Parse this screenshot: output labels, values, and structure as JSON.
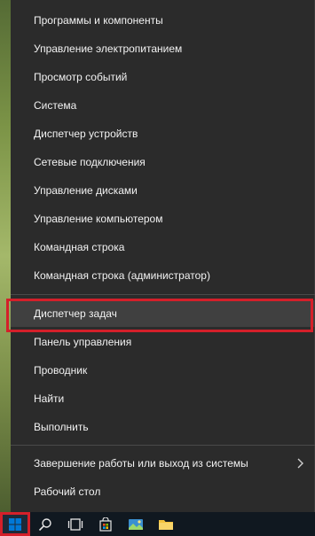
{
  "menu": {
    "items": [
      {
        "label": "Программы и компоненты"
      },
      {
        "label": "Управление электропитанием"
      },
      {
        "label": "Просмотр событий"
      },
      {
        "label": "Система"
      },
      {
        "label": "Диспетчер устройств"
      },
      {
        "label": "Сетевые подключения"
      },
      {
        "label": "Управление дисками"
      },
      {
        "label": "Управление компьютером"
      },
      {
        "label": "Командная строка"
      },
      {
        "label": "Командная строка (администратор)"
      },
      {
        "label": "Диспетчер задач"
      },
      {
        "label": "Панель управления"
      },
      {
        "label": "Проводник"
      },
      {
        "label": "Найти"
      },
      {
        "label": "Выполнить"
      },
      {
        "label": "Завершение работы или выход из системы"
      },
      {
        "label": "Рабочий стол"
      }
    ],
    "highlighted_item": "Диспетчер задач"
  },
  "taskbar": {
    "icons": [
      "windows-start-icon",
      "search-icon",
      "task-view-icon",
      "store-icon",
      "photos-icon",
      "file-explorer-icon"
    ]
  },
  "colors": {
    "menu_bg": "#2b2b2b",
    "highlight_bg": "#404040",
    "annotation_red": "#d4202a",
    "taskbar_bg": "#101820",
    "windows_blue": "#0078d7"
  }
}
